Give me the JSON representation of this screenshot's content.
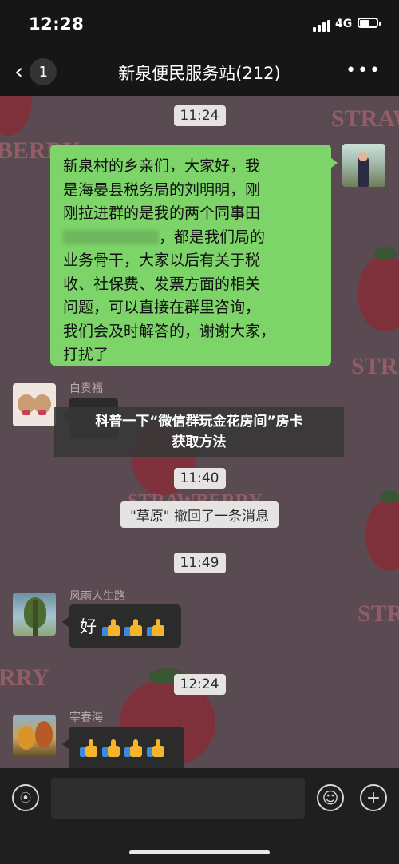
{
  "status": {
    "time": "12:28",
    "network": "4G"
  },
  "nav": {
    "back_count": "1",
    "title": "新泉便民服务站(212)",
    "more": "•••"
  },
  "messages": {
    "t1": "11:24",
    "self_lines": [
      "新泉村的乡亲们，大家好，我",
      "是海晏县税务局的刘明明，刚",
      "刚拉进群的是我的两个同事田",
      "，都是我们局的",
      "业务骨干，大家以后有关于税",
      "收、社保费、发票方面的相关",
      "问题，可以直接在群里咨询，",
      "我们会及时解答的，谢谢大家，",
      "打扰了"
    ],
    "sender1": "白贵福",
    "t2": "11:40",
    "recall": "\"草原\" 撤回了一条消息",
    "t3": "11:49",
    "sender2": "风雨人生路",
    "reply_text": "好",
    "t4": "12:24",
    "sender3": "宰春海"
  },
  "background_words": [
    "STRAW",
    "BERRY",
    "STR",
    "STRAWBERRY",
    "STR",
    "RRY"
  ],
  "overlay": {
    "line1": "科普一下“微信群玩金花房间”房卡",
    "line2": "获取方法"
  },
  "icons": {
    "voice": "voice-icon",
    "emoji": "emoji-icon",
    "plus": "plus-icon",
    "thumb": "thumbs-up-emoji"
  },
  "colors": {
    "self_bubble": "#7dd468",
    "chat_bg": "#5a4a51",
    "dark_bubble": "#2b2b2b"
  }
}
